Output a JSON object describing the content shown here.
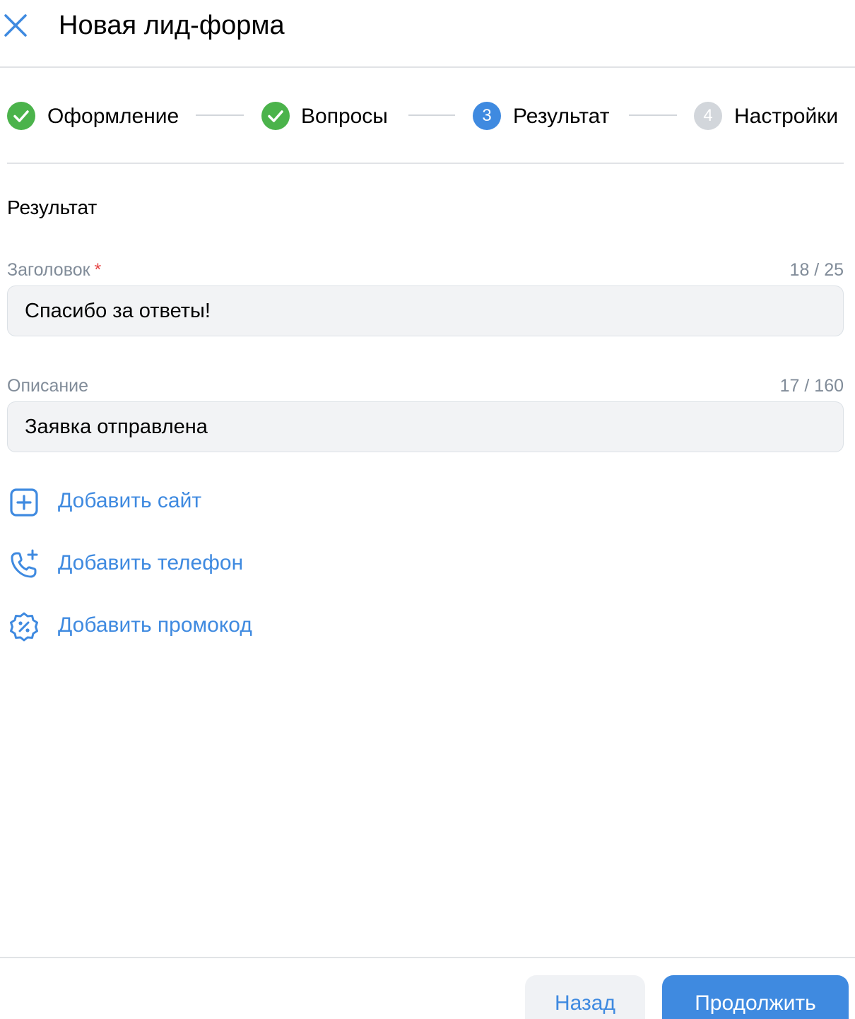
{
  "header": {
    "title": "Новая лид-форма"
  },
  "stepper": {
    "steps": [
      {
        "label": "Оформление",
        "state": "done"
      },
      {
        "label": "Вопросы",
        "state": "done"
      },
      {
        "label": "Результат",
        "state": "active",
        "number": "3"
      },
      {
        "label": "Настройки",
        "state": "todo",
        "number": "4"
      }
    ]
  },
  "section": {
    "title": "Результат"
  },
  "fields": {
    "heading": {
      "label": "Заголовок",
      "required_mark": "*",
      "counter": "18 / 25",
      "value": "Спасибо за ответы!"
    },
    "description": {
      "label": "Описание",
      "counter": "17 / 160",
      "value": "Заявка отправлена"
    }
  },
  "actions": {
    "add_site": "Добавить сайт",
    "add_phone": "Добавить телефон",
    "add_promocode": "Добавить промокод"
  },
  "footer": {
    "back_label": "Назад",
    "next_label": "Продолжить"
  },
  "colors": {
    "accent": "#3f8ae0",
    "success": "#4bb34b",
    "inactive": "#d2d6db",
    "required": "#e64646"
  }
}
